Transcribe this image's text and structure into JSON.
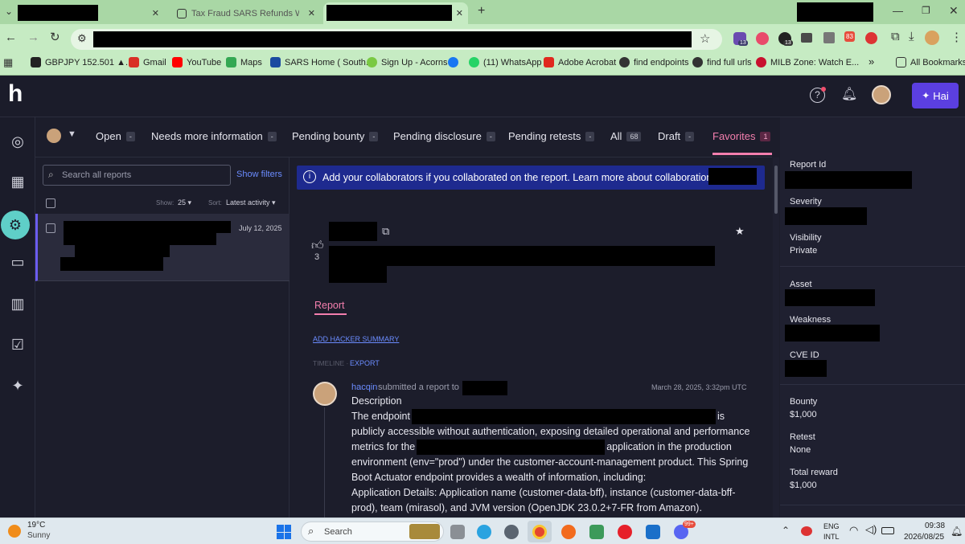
{
  "browser": {
    "tabs": [
      {
        "label": "",
        "redacted": true
      },
      {
        "label": "Tax Fraud SARS Refunds Warnin",
        "redacted": false
      },
      {
        "label": "",
        "redacted": true
      }
    ],
    "new_tab_label": "+",
    "bookmarks": [
      {
        "label": "GBPJPY 152.501 ▲...",
        "color": "#222222"
      },
      {
        "label": "Gmail",
        "color": "#d93025"
      },
      {
        "label": "YouTube",
        "color": "#ff0000"
      },
      {
        "label": "Maps",
        "color": "#34a853"
      },
      {
        "label": "SARS Home ( South...",
        "color": "#1a4aa0"
      },
      {
        "label": "Sign Up - Acorns",
        "color": "#7ac943"
      },
      {
        "label": "",
        "color": "#1877f2"
      },
      {
        "label": "(11) WhatsApp",
        "color": "#25d366"
      },
      {
        "label": "Adobe Acrobat",
        "color": "#e0281e"
      },
      {
        "label": "find endpoints",
        "color": "#333333"
      },
      {
        "label": "find full urls",
        "color": "#333333"
      },
      {
        "label": "MILB Zone: Watch E...",
        "color": "#c8102e"
      }
    ],
    "more_bookmarks": "»",
    "all_bookmarks": "All Bookmarks",
    "ext_badges": [
      "13",
      "13",
      "83"
    ]
  },
  "app": {
    "logo": "h",
    "hai_label": "Hai",
    "filter_tabs": [
      {
        "label": "Open",
        "count": "-"
      },
      {
        "label": "Needs more information",
        "count": "-"
      },
      {
        "label": "Pending bounty",
        "count": "-"
      },
      {
        "label": "Pending disclosure",
        "count": "-"
      },
      {
        "label": "Pending retests",
        "count": "-"
      },
      {
        "label": "All",
        "count": "68"
      },
      {
        "label": "Draft",
        "count": "-"
      },
      {
        "label": "Favorites",
        "count": "1"
      }
    ],
    "active_tab": "Favorites",
    "search_placeholder": "Search all reports",
    "show_filters": "Show filters",
    "show_label": "Show:",
    "show_value": "25",
    "sort_label": "Sort:",
    "sort_value": "Latest activity",
    "list_item_date": "July 12, 2025",
    "banner_text": "Add your collaborators if you collaborated on the report. Learn more about collaboration",
    "upvotes": "3",
    "report_tab": "Report",
    "add_summary": "ADD HACKER SUMMARY",
    "timeline_label": "TIMELINE ·",
    "export_label": "EXPORT",
    "author": "hacqin",
    "submitted_text": "submitted a report to",
    "submitted_date": "March 28, 2025, 3:32pm UTC",
    "description_heading": "Description",
    "desc_line1_a": "The endpoint",
    "desc_line1_b": "is",
    "desc_line2": "publicly accessible without authentication, exposing detailed operational and performance",
    "desc_line3_a": "metrics for the",
    "desc_line3_b": "application in the production",
    "desc_line4": "environment (env=\"prod\") under the customer-account-management product. This Spring",
    "desc_line5": "Boot Actuator endpoint provides a wealth of information, including:",
    "desc_line6": "Application Details: Application name (customer-data-bff), instance (customer-data-bff-",
    "desc_line7": "prod), team (mirasol), and JVM version (OpenJDK 23.0.2+7-FR from Amazon)."
  },
  "sidebar": {
    "report_id_label": "Report Id",
    "severity_label": "Severity",
    "visibility_label": "Visibility",
    "visibility_value": "Private",
    "asset_label": "Asset",
    "weakness_label": "Weakness",
    "cve_label": "CVE ID",
    "bounty_label": "Bounty",
    "bounty_value": "$1,000",
    "retest_label": "Retest",
    "retest_value": "None",
    "total_label": "Total reward",
    "total_value": "$1,000"
  },
  "taskbar": {
    "weather_temp": "19°C",
    "weather_desc": "Sunny",
    "search_label": "Search",
    "lang1": "ENG",
    "lang2": "INTL",
    "time": "09:38",
    "date": "2026/08/25",
    "badge": "99+"
  },
  "colors": {
    "accent": "#f47fae",
    "hai_button": "#5b3fe0",
    "banner": "#1e2a8f",
    "link": "#6b8cff"
  }
}
